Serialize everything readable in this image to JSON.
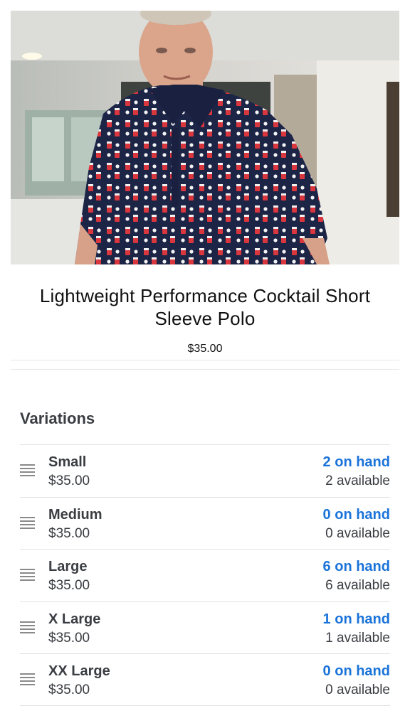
{
  "product": {
    "image_alt": "Man wearing a navy polo shirt with cocktail glass print",
    "title": "Lightweight Performance Cocktail Short Sleeve Polo",
    "price": "$35.00"
  },
  "variations_section": {
    "title": "Variations",
    "items": [
      {
        "name": "Small",
        "price": "$35.00",
        "on_hand": "2 on hand",
        "available": "2 available"
      },
      {
        "name": "Medium",
        "price": "$35.00",
        "on_hand": "0 on hand",
        "available": "0 available"
      },
      {
        "name": "Large",
        "price": "$35.00",
        "on_hand": "6 on hand",
        "available": "6 available"
      },
      {
        "name": "X Large",
        "price": "$35.00",
        "on_hand": "1 on hand",
        "available": "1 available"
      },
      {
        "name": "XX Large",
        "price": "$35.00",
        "on_hand": "0 on hand",
        "available": "0 available"
      }
    ]
  },
  "colors": {
    "accent_blue": "#1a73d9",
    "text_dark": "#3a3d42",
    "shirt_navy": "#1d2547"
  },
  "icons": {
    "row_handle": "drag-handle-icon"
  }
}
